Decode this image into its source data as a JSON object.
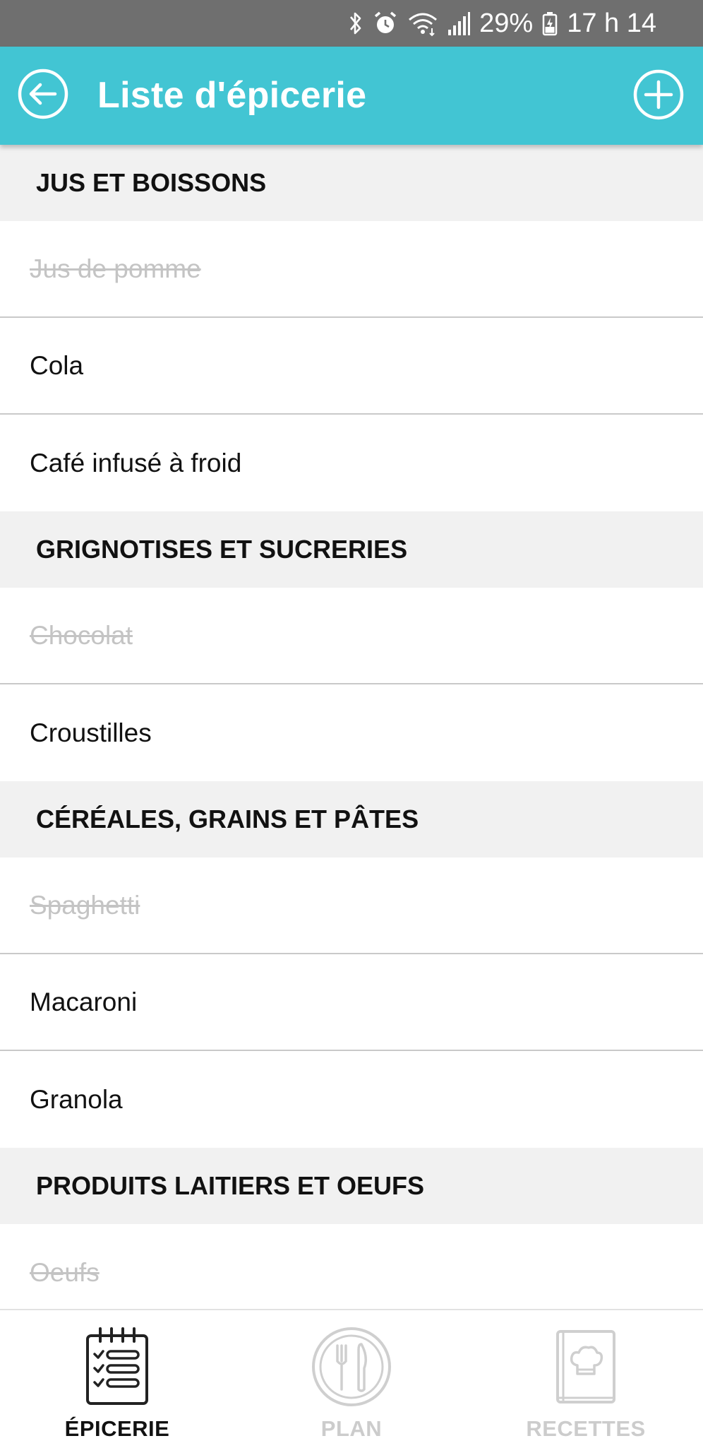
{
  "status_bar": {
    "battery": "29%",
    "time": "17 h 14",
    "icons": [
      "bluetooth-icon",
      "alarm-icon",
      "wifi-icon",
      "signal-icon",
      "battery-icon"
    ]
  },
  "app_bar": {
    "title": "Liste d'épicerie",
    "back_icon": "back-arrow-icon",
    "add_icon": "add-circle-icon",
    "color": "#42c5d3"
  },
  "sections": [
    {
      "title": "JUS ET BOISSONS",
      "items": [
        {
          "label": "Jus de pomme",
          "checked": true
        },
        {
          "label": "Cola",
          "checked": false
        },
        {
          "label": "Café infusé à froid",
          "checked": false
        }
      ]
    },
    {
      "title": "GRIGNOTISES ET SUCRERIES",
      "items": [
        {
          "label": "Chocolat",
          "checked": true
        },
        {
          "label": "Croustilles",
          "checked": false
        }
      ]
    },
    {
      "title": "CÉRÉALES, GRAINS ET PÂTES",
      "items": [
        {
          "label": "Spaghetti",
          "checked": true
        },
        {
          "label": "Macaroni",
          "checked": false
        },
        {
          "label": "Granola",
          "checked": false
        }
      ]
    },
    {
      "title": "PRODUITS LAITIERS ET OEUFS",
      "items": [
        {
          "label": "Oeufs",
          "checked": true
        }
      ]
    }
  ],
  "bottom_nav": [
    {
      "label": "ÉPICERIE",
      "icon": "grocery-checklist-icon",
      "active": true
    },
    {
      "label": "PLAN",
      "icon": "plate-utensils-icon",
      "active": false
    },
    {
      "label": "RECETTES",
      "icon": "recipe-book-icon",
      "active": false
    }
  ]
}
